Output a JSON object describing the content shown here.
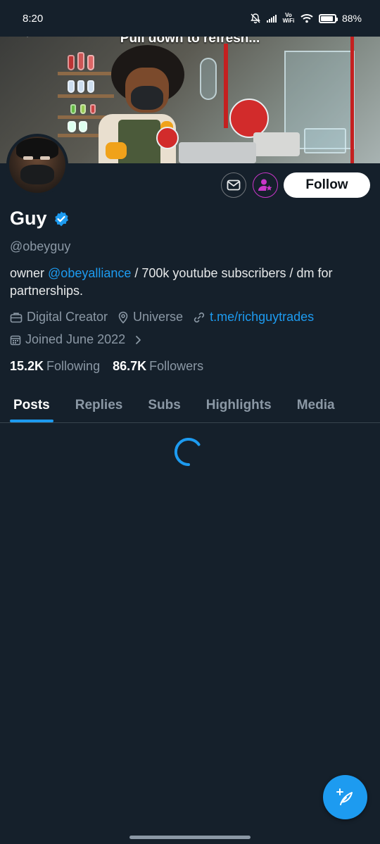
{
  "status_bar": {
    "time": "8:20",
    "network_label": "Vo WiFi",
    "battery_percent": 88,
    "battery_label": "88%"
  },
  "banner": {
    "pull_to_refresh_text": "Pull down to refresh..."
  },
  "profile": {
    "name": "Guy",
    "verified": true,
    "handle": "@obeyguy",
    "bio": {
      "prefix": "owner ",
      "mention": "@obeyalliance",
      "suffix": " / 700k youtube subscribers / dm for partnerships."
    },
    "category": "Digital Creator",
    "location": "Universe",
    "website": "t.me/richguytrades",
    "joined": "Joined June 2022",
    "following_count": "15.2K",
    "following_label": "Following",
    "followers_count": "86.7K",
    "followers_label": "Followers"
  },
  "actions": {
    "message_icon": "envelope-icon",
    "subscribe_icon": "person-star-icon",
    "follow_label": "Follow"
  },
  "tabs": [
    {
      "label": "Posts",
      "active": true
    },
    {
      "label": "Replies",
      "active": false
    },
    {
      "label": "Subs",
      "active": false
    },
    {
      "label": "Highlights",
      "active": false
    },
    {
      "label": "Media",
      "active": false
    }
  ],
  "compose_icon": "feather-plus-icon",
  "colors": {
    "background": "#15202b",
    "accent": "#1d9bf0",
    "muted_text": "#8b98a5",
    "subscribe_ring": "#c936c9"
  }
}
